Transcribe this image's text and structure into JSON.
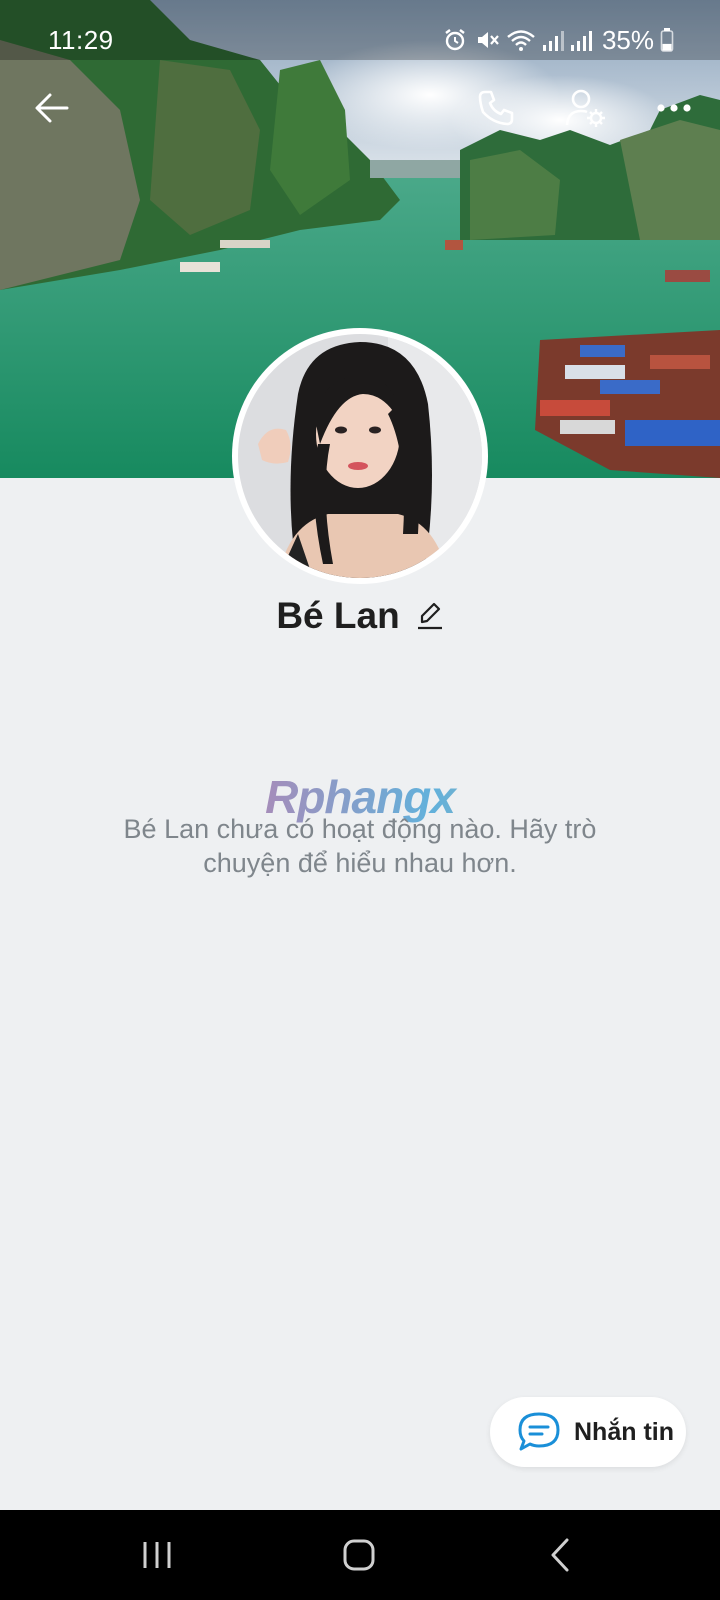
{
  "status_bar": {
    "time": "11:29",
    "battery_percent": "35%",
    "battery_level": 0.35,
    "icons": [
      "alarm-icon",
      "mute-icon",
      "wifi-icon",
      "signal-icon",
      "signal-icon",
      "battery-icon"
    ]
  },
  "toolbar": {
    "back_icon": "arrow-left-icon",
    "call_icon": "phone-icon",
    "profile_settings_icon": "user-settings-icon",
    "more_icon": "more-horizontal-icon"
  },
  "profile": {
    "name": "Bé Lan",
    "edit_icon": "pencil-icon"
  },
  "watermark": "Rphangx",
  "empty_state": {
    "message": "Bé Lan chưa có hoạt động nào. Hãy trò chuyện để hiểu nhau hơn."
  },
  "message_button": {
    "label": "Nhắn tin",
    "icon": "chat-bubble-icon"
  },
  "nav_bar": {
    "icons": [
      "recents-icon",
      "home-icon",
      "back-icon"
    ]
  },
  "colors": {
    "background": "#eef0f2",
    "accent": "#1a8fd8",
    "text_primary": "#1f1f1f",
    "text_secondary": "#7f868c"
  }
}
